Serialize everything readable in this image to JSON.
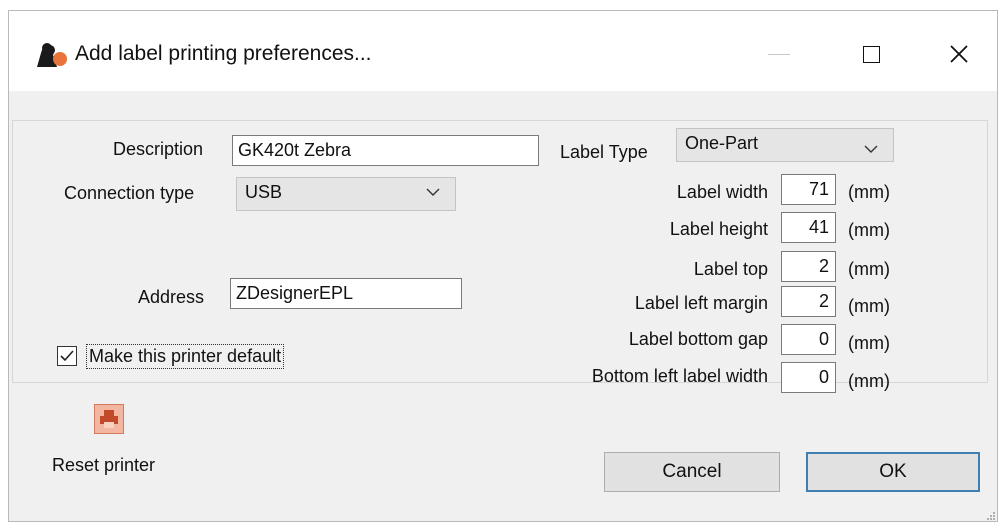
{
  "window": {
    "title": "Add label printing preferences...",
    "icon": "app-icon"
  },
  "form": {
    "description": {
      "label": "Description",
      "value": "GK420t Zebra"
    },
    "connection_type": {
      "label": "Connection type",
      "value": "USB"
    },
    "address": {
      "label": "Address",
      "value": "ZDesignerEPL"
    },
    "make_default": {
      "label": "Make this printer default",
      "checked": true
    },
    "label_type": {
      "label": "Label Type",
      "value": "One-Part"
    },
    "unit": "(mm)",
    "dimensions": [
      {
        "label": "Label width",
        "value": "71"
      },
      {
        "label": "Label height",
        "value": "41"
      },
      {
        "label": "Label top",
        "value": "2"
      },
      {
        "label": "Label left margin",
        "value": "2"
      },
      {
        "label": "Label bottom gap",
        "value": "0"
      },
      {
        "label": "Bottom left label width",
        "value": "0"
      }
    ]
  },
  "actions": {
    "reset_label": "Reset printer",
    "cancel_label": "Cancel",
    "ok_label": "OK"
  }
}
